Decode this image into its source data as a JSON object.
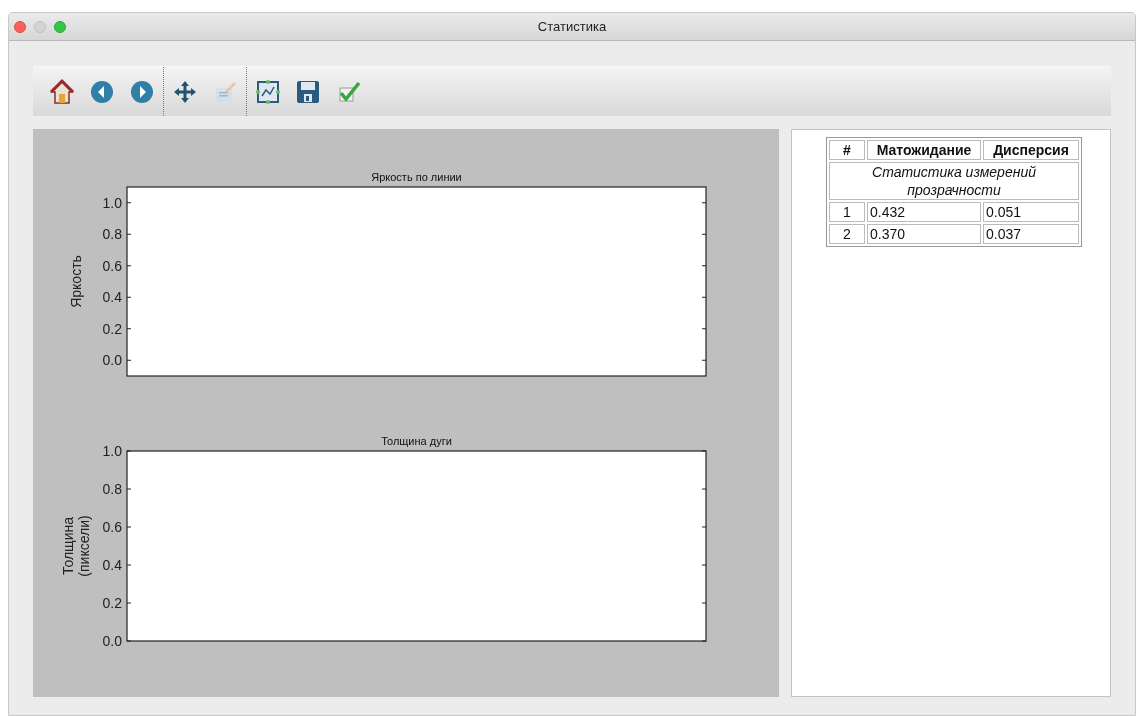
{
  "window": {
    "title": "Статистика"
  },
  "toolbar": {
    "groups": [
      [
        {
          "disabled": false
        },
        {
          "disabled": false
        },
        {
          "disabled": false
        }
      ],
      [
        {
          "disabled": false
        },
        {
          "disabled": true
        }
      ],
      [
        {
          "disabled": false
        },
        {
          "disabled": false
        },
        {
          "disabled": false
        }
      ]
    ]
  },
  "charts": [
    {
      "title": "Яркость по линии",
      "ylabel": "Яркость",
      "yticks": [
        "1.0",
        "0.8",
        "0.6",
        "0.4",
        "0.2",
        "0.0"
      ]
    },
    {
      "title": "Толщина дуги",
      "ylabel": "Толщина\n(пиксели)",
      "yticks": [
        "1.0",
        "0.8",
        "0.6",
        "0.4",
        "0.2",
        "0.0"
      ]
    }
  ],
  "table": {
    "columns": [
      "#",
      "Матожидание",
      "Дисперсия"
    ],
    "caption": "Статистика измерений прозрачности",
    "rows": [
      [
        "1",
        "0.432",
        "0.051"
      ],
      [
        "2",
        "0.370",
        "0.037"
      ]
    ]
  }
}
